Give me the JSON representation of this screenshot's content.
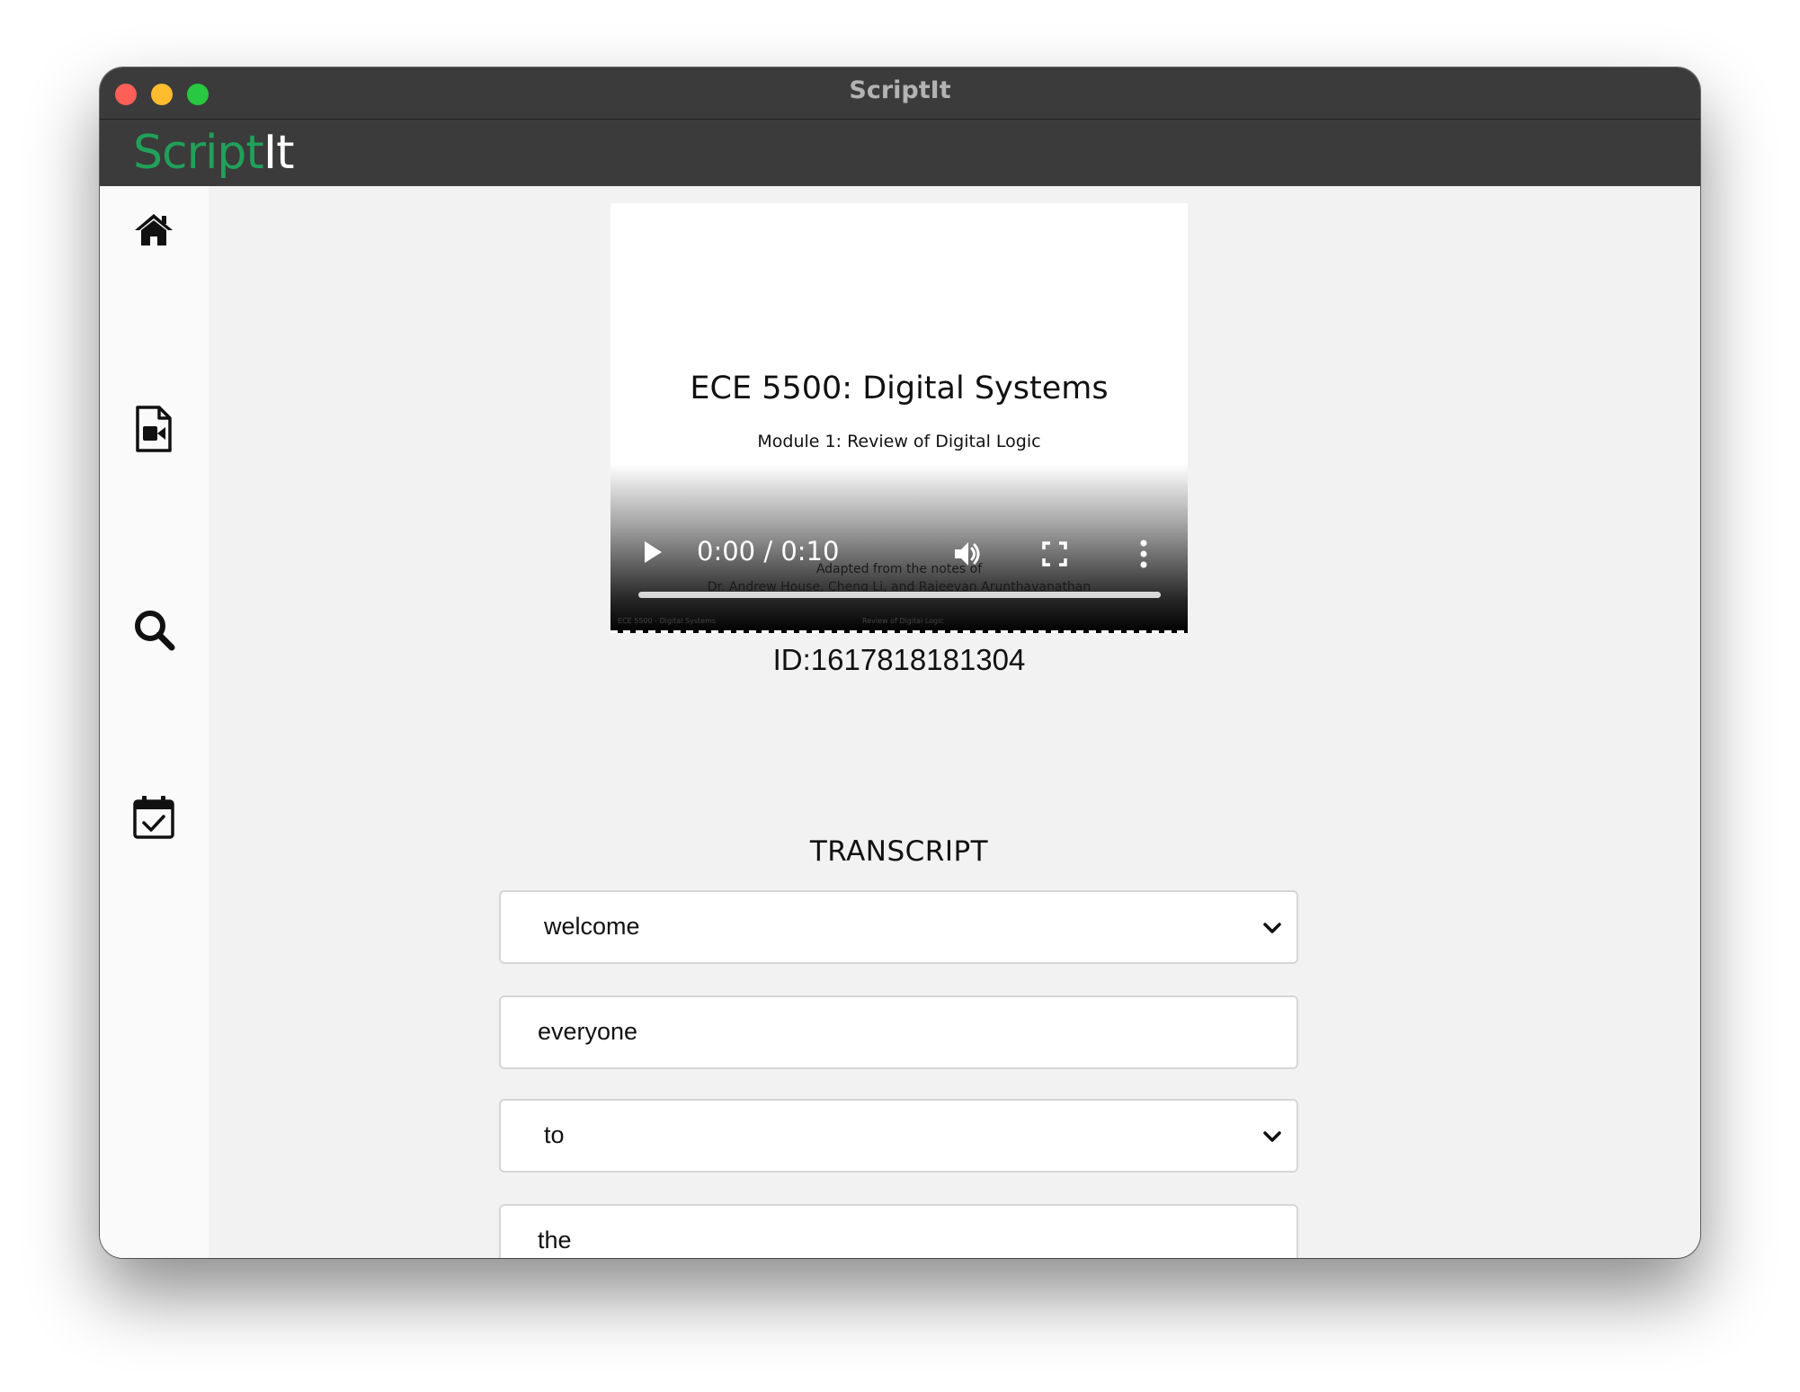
{
  "window": {
    "title": "ScriptIt"
  },
  "app": {
    "logo_part1": "Script",
    "logo_part2": "It"
  },
  "sidebar": {
    "items": [
      {
        "icon": "home-icon"
      },
      {
        "icon": "video-file-icon"
      },
      {
        "icon": "search-icon"
      },
      {
        "icon": "calendar-check-icon"
      }
    ]
  },
  "video": {
    "slide_title": "ECE 5500: Digital Systems",
    "slide_subtitle": "Module 1: Review of Digital Logic",
    "slide_notes_line1": "Adapted from the notes of",
    "slide_notes_line2": "Dr. Andrew House, Cheng Li, and Rajeevan Arunthavanathan",
    "slide_footer_left": "ECE 5500 - Digital Systems",
    "slide_footer_center": "Review of Digital Logic",
    "time": "0:00 / 0:10",
    "progress": 0
  },
  "media": {
    "id_text": "ID:1617818181304"
  },
  "transcript": {
    "heading": "TRANSCRIPT",
    "words": [
      {
        "value": "welcome",
        "kind": "select"
      },
      {
        "value": "everyone",
        "kind": "input"
      },
      {
        "value": "to",
        "kind": "select"
      },
      {
        "value": "the",
        "kind": "input"
      }
    ]
  },
  "colors": {
    "brand_green": "#21a05a",
    "titlebar": "#3b3b3b"
  }
}
